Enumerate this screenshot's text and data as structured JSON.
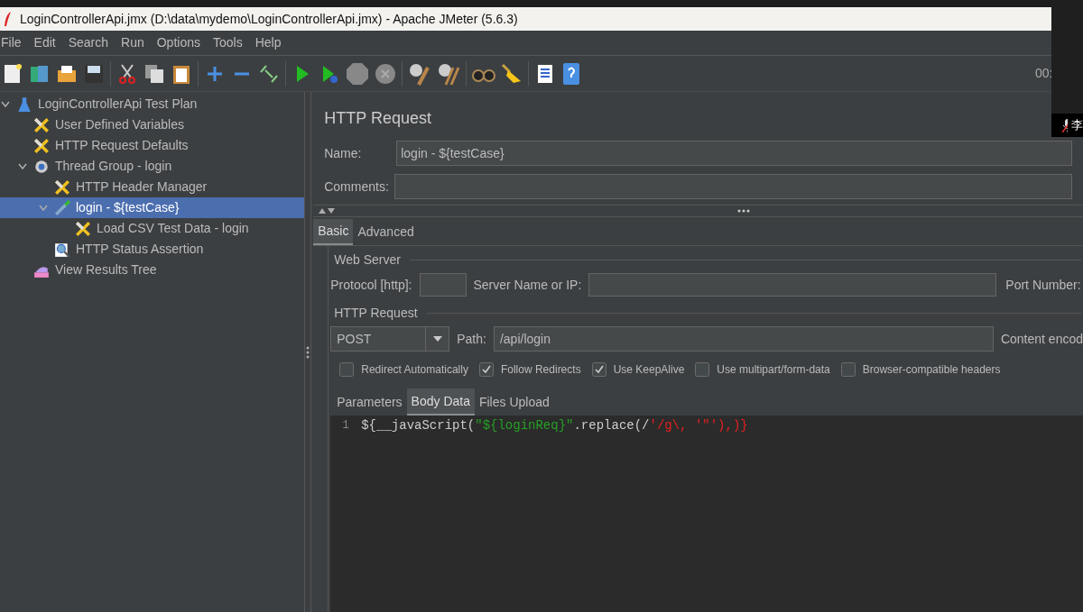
{
  "window": {
    "title": "LoginControllerApi.jmx (D:\\data\\mydemo\\LoginControllerApi.jmx) - Apache JMeter (5.6.3)"
  },
  "menu": [
    "File",
    "Edit",
    "Search",
    "Run",
    "Options",
    "Tools",
    "Help"
  ],
  "toolbar": {
    "timer": "00:"
  },
  "overlay": {
    "text": "李"
  },
  "tree": [
    {
      "label": "LoginControllerApi Test Plan",
      "kind": "plan",
      "expanded": true,
      "selected": false,
      "children": [
        {
          "label": "User Defined Variables",
          "kind": "config",
          "selected": false
        },
        {
          "label": "HTTP Request Defaults",
          "kind": "config",
          "selected": false
        },
        {
          "label": "Thread Group - login",
          "kind": "thread",
          "expanded": true,
          "selected": false,
          "children": [
            {
              "label": "HTTP Header Manager",
              "kind": "config",
              "selected": false
            },
            {
              "label": "login - ${testCase}",
              "kind": "sampler",
              "expanded": true,
              "selected": true,
              "children": [
                {
                  "label": "Load CSV Test Data - login",
                  "kind": "config",
                  "selected": false
                }
              ]
            },
            {
              "label": "HTTP Status Assertion",
              "kind": "assertion",
              "selected": false
            }
          ]
        },
        {
          "label": "View Results Tree",
          "kind": "listener",
          "selected": false
        }
      ]
    }
  ],
  "panel": {
    "title": "HTTP Request",
    "name_label": "Name:",
    "name_value": "login - ${testCase}",
    "comments_label": "Comments:",
    "tabs": [
      {
        "label": "Basic",
        "selected": true
      },
      {
        "label": "Advanced",
        "selected": false
      }
    ],
    "web_server": {
      "legend": "Web Server",
      "protocol_label": "Protocol [http]:",
      "server_label": "Server Name or IP:",
      "port_label": "Port Number:"
    },
    "http_request": {
      "legend": "HTTP Request",
      "method": "POST",
      "path_label": "Path:",
      "path_value": "/api/login",
      "encoding_label": "Content encod"
    },
    "options": [
      {
        "label": "Redirect Automatically",
        "checked": false
      },
      {
        "label": "Follow Redirects",
        "checked": true
      },
      {
        "label": "Use KeepAlive",
        "checked": true
      },
      {
        "label": "Use multipart/form-data",
        "checked": false
      },
      {
        "label": "Browser-compatible headers",
        "checked": false
      }
    ],
    "body_tabs": [
      {
        "label": "Parameters",
        "selected": false
      },
      {
        "label": "Body Data",
        "selected": true
      },
      {
        "label": "Files Upload",
        "selected": false
      }
    ],
    "code": {
      "line_number": "1",
      "segments": [
        {
          "text": "${__javaScript(",
          "kind": "plain"
        },
        {
          "text": "\"${loginReq}\"",
          "kind": "string"
        },
        {
          "text": ".replace(/",
          "kind": "plain"
        },
        {
          "text": "'/g\\, '\"'),)}",
          "kind": "error"
        }
      ]
    }
  }
}
